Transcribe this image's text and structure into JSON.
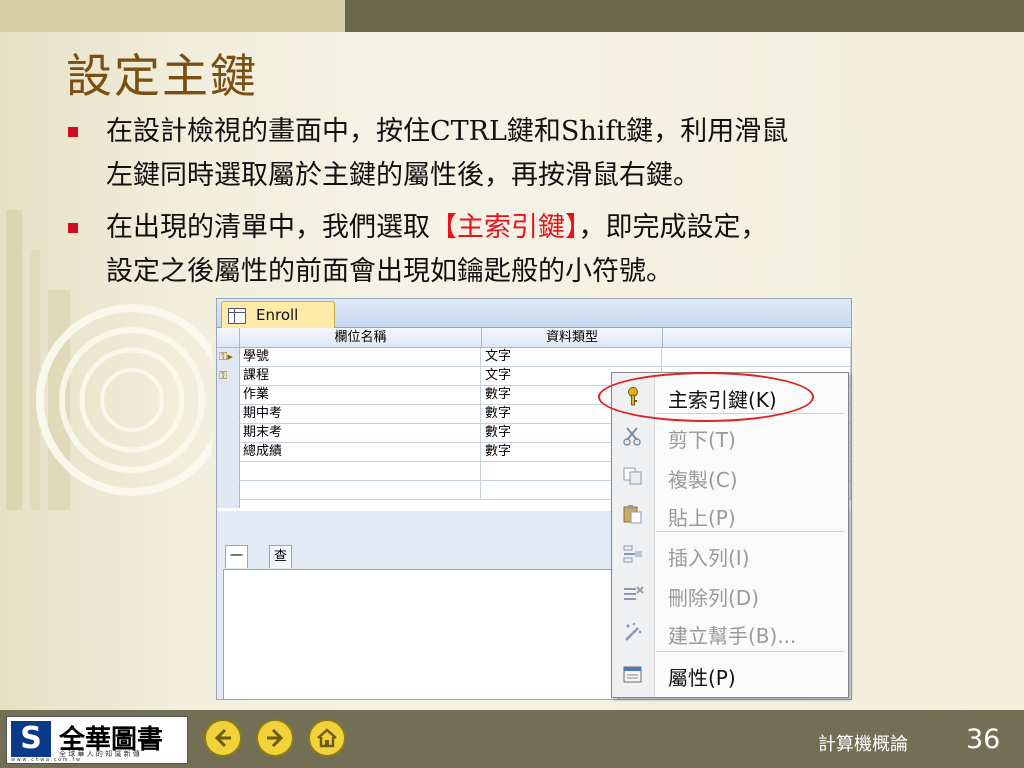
{
  "slide": {
    "title": "設定主鍵",
    "bullets": [
      {
        "lines": [
          "在設計檢視的畫面中，按住CTRL鍵和Shift鍵，利用滑鼠",
          "左鍵同時選取屬於主鍵的屬性後，再按滑鼠右鍵。"
        ]
      },
      {
        "line1_pre": "在出現的清單中，我們選取",
        "line1_hl": "【主索引鍵】",
        "line1_post": "，即完成設定，",
        "line2": "設定之後屬性的前面會出現如鑰匙般的小符號。"
      }
    ],
    "highlight_color": "#e8111c"
  },
  "access": {
    "table_tab": "Enroll",
    "headers": {
      "field": "欄位名稱",
      "type": "資料類型"
    },
    "rows": [
      {
        "field": "學號",
        "type": "文字",
        "key": true
      },
      {
        "field": "課程",
        "type": "文字",
        "key": true
      },
      {
        "field": "作業",
        "type": "數字",
        "key": false
      },
      {
        "field": "期中考",
        "type": "數字",
        "key": false
      },
      {
        "field": "期末考",
        "type": "數字",
        "key": false
      },
      {
        "field": "總成績",
        "type": "數字",
        "key": false
      }
    ],
    "property_tabs": [
      "一般",
      "查閱"
    ]
  },
  "context_menu": {
    "items": [
      {
        "label": "主索引鍵(K)",
        "icon": "key-icon",
        "active": true
      },
      {
        "label": "剪下(T)",
        "icon": "scissors-icon",
        "active": false
      },
      {
        "label": "複製(C)",
        "icon": "copy-icon",
        "active": false
      },
      {
        "label": "貼上(P)",
        "icon": "paste-icon",
        "active": false
      },
      {
        "label": "插入列(I)",
        "icon": "insert-row-icon",
        "active": false
      },
      {
        "label": "刪除列(D)",
        "icon": "delete-row-icon",
        "active": false
      },
      {
        "label": "建立幫手(B)...",
        "icon": "wand-icon",
        "active": false
      },
      {
        "label": "屬性(P)",
        "icon": "properties-icon",
        "active": true
      }
    ]
  },
  "footer": {
    "logo_name": "全華圖書",
    "logo_sub": "全 球 華 人 的 知 識 新 傳",
    "logo_url": "w w w . c h w a . c o m . t w",
    "course": "計算機概論",
    "page": "36"
  }
}
